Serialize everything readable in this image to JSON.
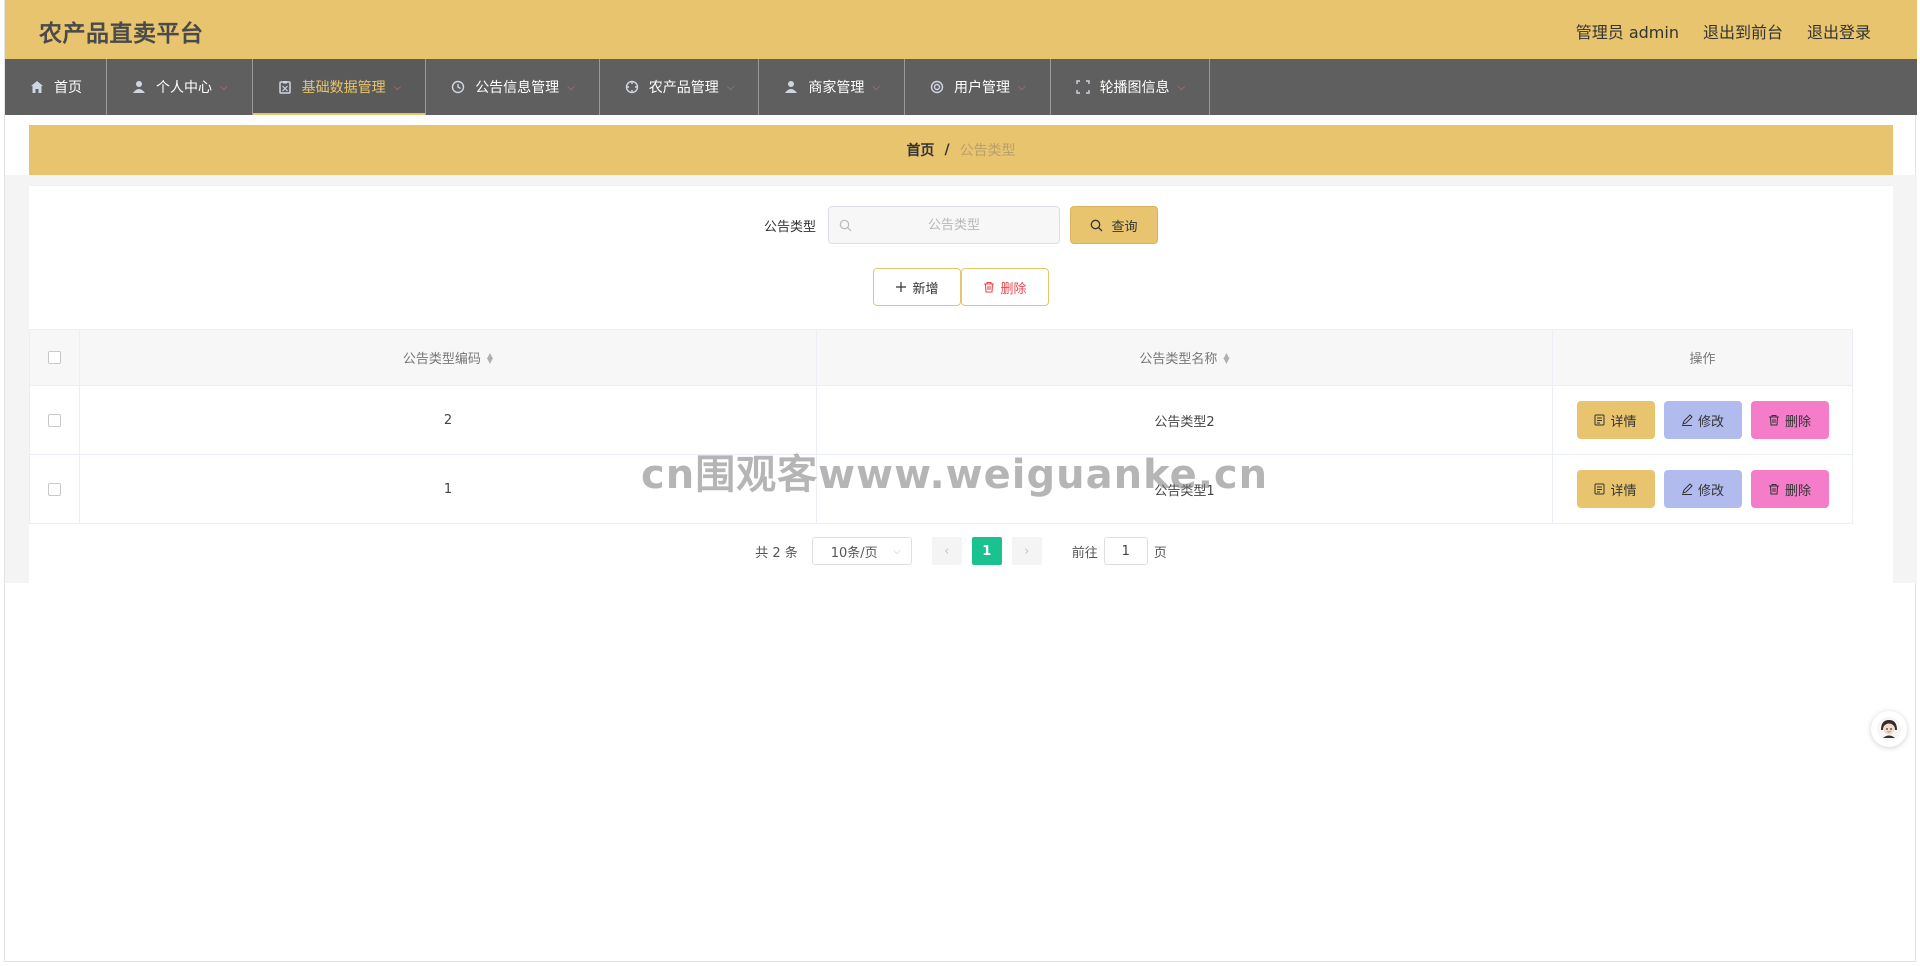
{
  "header": {
    "brand": "农产品直卖平台",
    "user_label": "管理员 admin",
    "to_front_label": "退出到前台",
    "logout_label": "退出登录"
  },
  "nav": {
    "items": [
      {
        "label": "首页",
        "icon": "home-icon",
        "has_menu": false,
        "active": false
      },
      {
        "label": "个人中心",
        "icon": "user-icon",
        "has_menu": true,
        "active": false
      },
      {
        "label": "基础数据管理",
        "icon": "clipboard-icon",
        "has_menu": true,
        "active": true
      },
      {
        "label": "公告信息管理",
        "icon": "clock-icon",
        "has_menu": true,
        "active": false
      },
      {
        "label": "农产品管理",
        "icon": "target-icon",
        "has_menu": true,
        "active": false
      },
      {
        "label": "商家管理",
        "icon": "user-icon",
        "has_menu": true,
        "active": false
      },
      {
        "label": "用户管理",
        "icon": "lifebuoy-icon",
        "has_menu": true,
        "active": false
      },
      {
        "label": "轮播图信息",
        "icon": "fullscreen-icon",
        "has_menu": true,
        "active": false
      }
    ]
  },
  "breadcrumb": {
    "home": "首页",
    "separator": "/",
    "current": "公告类型"
  },
  "search": {
    "label": "公告类型",
    "placeholder": "公告类型",
    "value": "",
    "button": "查询"
  },
  "actions": {
    "add": "新增",
    "delete": "删除"
  },
  "table": {
    "columns": {
      "code": "公告类型编码",
      "name": "公告类型名称",
      "ops": "操作"
    },
    "rows": [
      {
        "code": "2",
        "name": "公告类型2"
      },
      {
        "code": "1",
        "name": "公告类型1"
      }
    ],
    "op_labels": {
      "detail": "详情",
      "edit": "修改",
      "delete": "删除"
    }
  },
  "pagination": {
    "total": "共 2 条",
    "page_size": "10条/页",
    "current_page": "1",
    "goto_prefix": "前往",
    "goto_value": "1",
    "goto_suffix": "页"
  },
  "watermark": "cn围观客www.weiguanke.cn",
  "colors": {
    "accent": "#e8c46f",
    "nav_bg": "#5f5f5f",
    "page_active": "#19c28f",
    "edit_btn": "#b2bbee",
    "delete_btn": "#f47cc9"
  }
}
